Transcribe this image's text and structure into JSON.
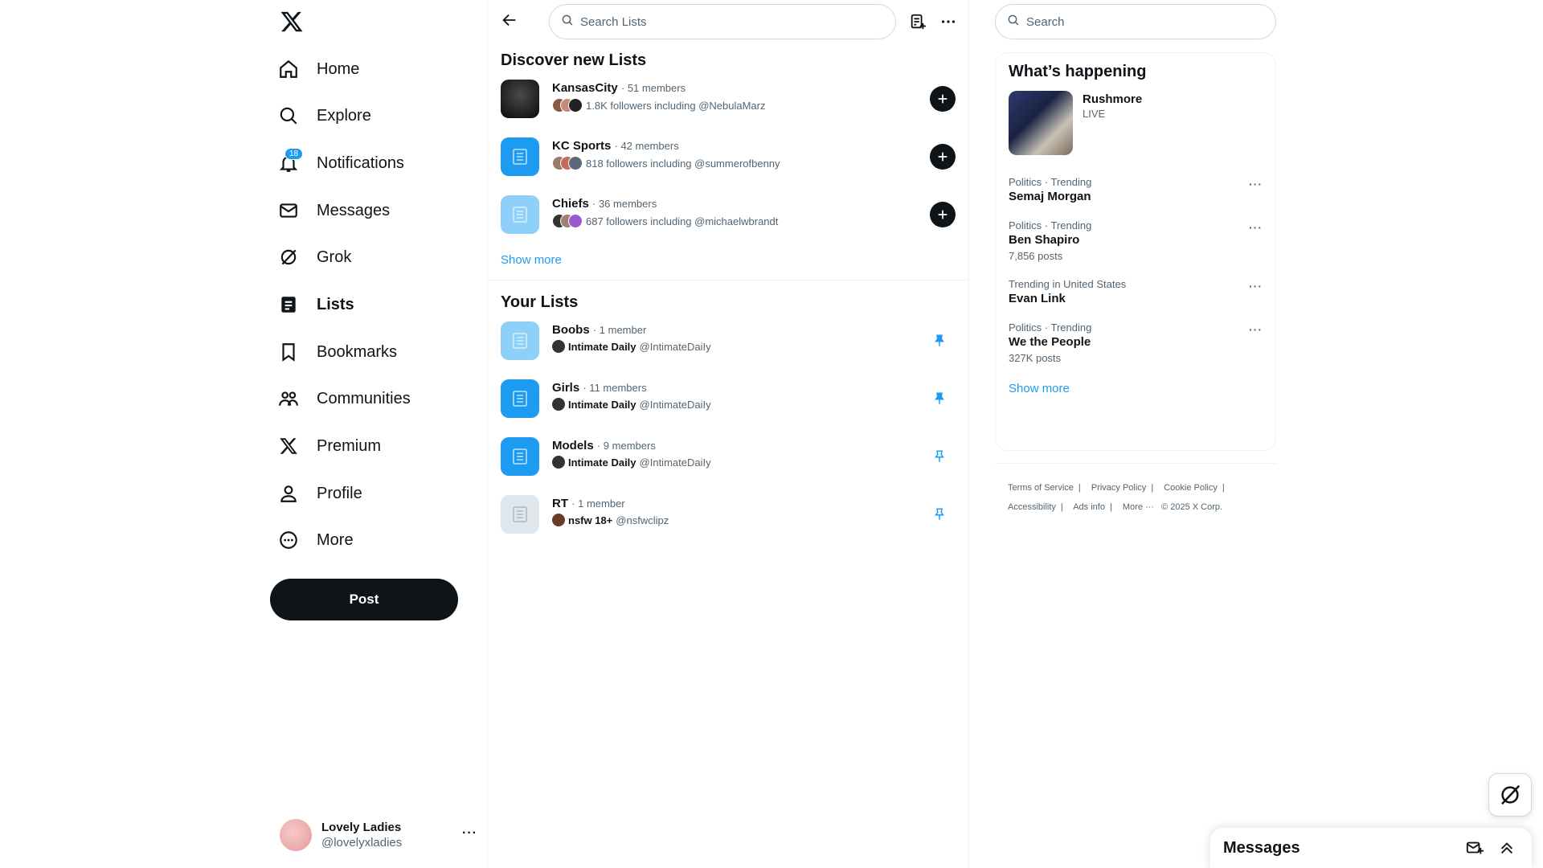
{
  "nav": {
    "items": [
      {
        "label": "Home",
        "icon": "home-icon"
      },
      {
        "label": "Explore",
        "icon": "search-icon"
      },
      {
        "label": "Notifications",
        "icon": "bell-icon",
        "badge": "18"
      },
      {
        "label": "Messages",
        "icon": "envelope-icon"
      },
      {
        "label": "Grok",
        "icon": "grok-icon"
      },
      {
        "label": "Lists",
        "icon": "lists-icon",
        "active": true
      },
      {
        "label": "Bookmarks",
        "icon": "bookmark-icon"
      },
      {
        "label": "Communities",
        "icon": "communities-icon"
      },
      {
        "label": "Premium",
        "icon": "x-logo-icon"
      },
      {
        "label": "Profile",
        "icon": "person-icon"
      },
      {
        "label": "More",
        "icon": "more-circle-icon"
      }
    ],
    "post_label": "Post"
  },
  "account": {
    "display_name": "Lovely Ladies",
    "handle": "@lovelyxladies"
  },
  "main": {
    "search_placeholder": "Search Lists",
    "discover_title": "Discover new Lists",
    "discover": [
      {
        "name": "KansasCity",
        "meta": "· 51 members",
        "followers": "1.8K followers including @NebulaMarz"
      },
      {
        "name": "KC Sports",
        "meta": "· 42 members",
        "followers": "818 followers including @summerofbenny"
      },
      {
        "name": "Chiefs",
        "meta": "· 36 members",
        "followers": "687 followers including @michaelwbrandt"
      }
    ],
    "discover_show_more": "Show more",
    "your_lists_title": "Your Lists",
    "your_lists": [
      {
        "name": "Boobs",
        "meta": "· 1 member",
        "owner": "Intimate Daily",
        "owner_handle": "@IntimateDaiIy",
        "pinned": true
      },
      {
        "name": "Girls",
        "meta": "· 11 members",
        "owner": "Intimate Daily",
        "owner_handle": "@IntimateDaiIy",
        "pinned": true
      },
      {
        "name": "Models",
        "meta": "· 9 members",
        "owner": "Intimate Daily",
        "owner_handle": "@IntimateDaiIy",
        "pinned": false
      },
      {
        "name": "RT",
        "meta": "· 1 member",
        "owner": "nsfw 18+",
        "owner_handle": "@nsfwclipz",
        "pinned": false
      }
    ]
  },
  "right": {
    "search_placeholder": "Search",
    "happening_title": "What’s happening",
    "feature": {
      "name": "Rushmore",
      "status": "LIVE"
    },
    "trends": [
      {
        "context": "Politics · Trending",
        "name": "Semaj Morgan",
        "posts": ""
      },
      {
        "context": "Politics · Trending",
        "name": "Ben Shapiro",
        "posts": "7,856 posts"
      },
      {
        "context": "Trending in United States",
        "name": "Evan Link",
        "posts": ""
      },
      {
        "context": "Politics · Trending",
        "name": "We the People",
        "posts": "327K posts"
      }
    ],
    "show_more": "Show more",
    "footer": {
      "terms": "Terms of Service",
      "privacy": "Privacy Policy",
      "cookie": "Cookie Policy",
      "accessibility": "Accessibility",
      "ads": "Ads info",
      "more": "More ···",
      "copyright": "© 2025 X Corp."
    }
  },
  "messages_drawer": {
    "title": "Messages"
  },
  "colors": {
    "accent": "#1d9bf0",
    "text": "#0f1419",
    "muted": "#536471",
    "border": "#eff3f4"
  }
}
